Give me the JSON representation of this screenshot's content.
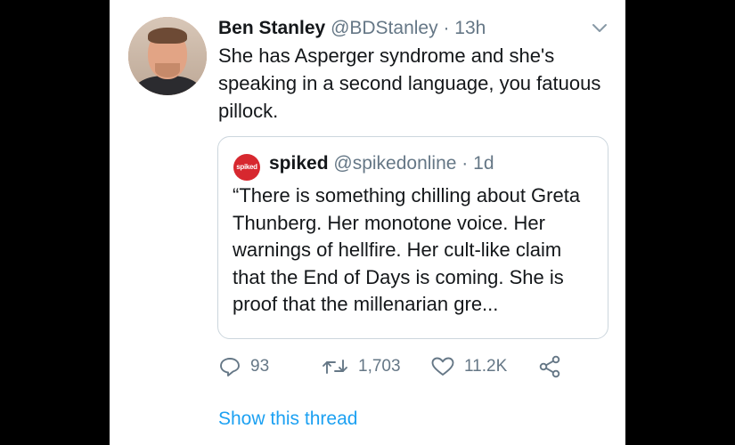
{
  "tweet": {
    "author_name": "Ben Stanley",
    "handle": "@BDStanley",
    "separator": "·",
    "time": "13h",
    "text": "She has Asperger syndrome and she's speaking in a second language, you fatuous pillock."
  },
  "quoted_tweet": {
    "avatar_label": "spiked",
    "author_name": "spiked",
    "handle": "@spikedonline",
    "separator": "·",
    "time": "1d",
    "text": "“There is something chilling about Greta Thunberg. Her monotone voice. Her warnings of hellfire. Her cult-like claim that the End of Days is coming. She is proof that the millenarian gre..."
  },
  "actions": {
    "reply_count": "93",
    "retweet_count": "1,703",
    "like_count": "11.2K"
  },
  "show_thread_label": "Show this thread",
  "colors": {
    "text": "#14171a",
    "secondary": "#657786",
    "link": "#1da1f2",
    "border": "#ccd6dd",
    "spiked_red": "#d7282f"
  }
}
